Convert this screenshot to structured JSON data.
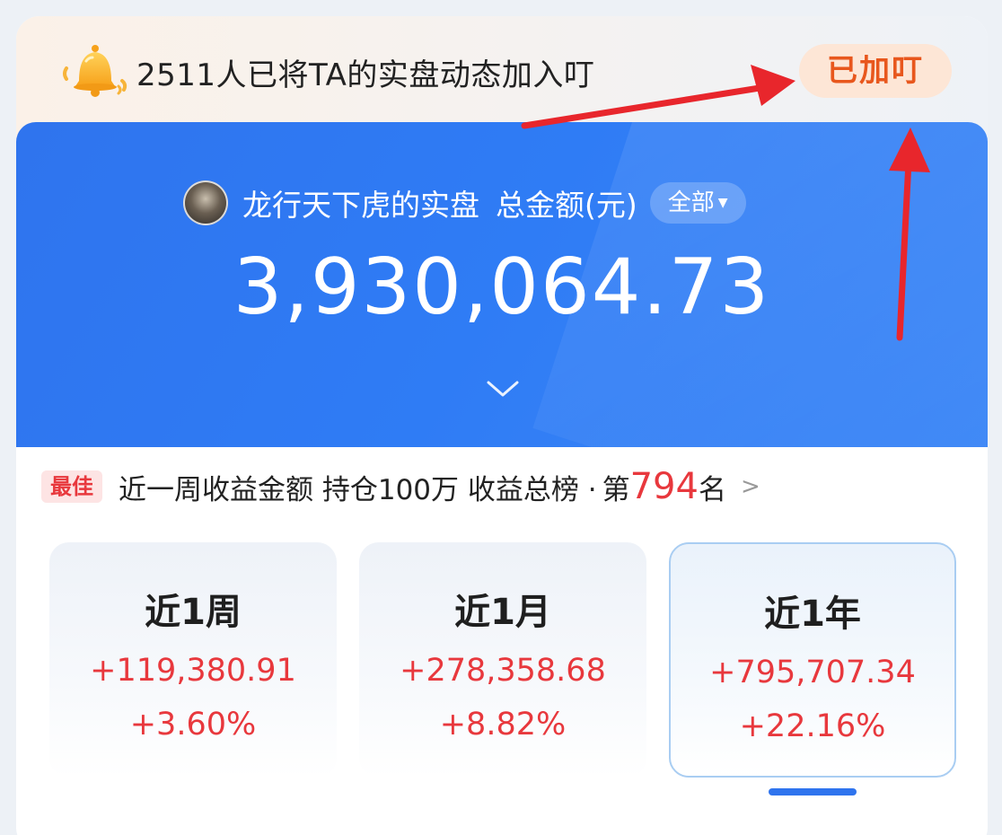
{
  "notify": {
    "text": "2511人已将TA的实盘动态加入叮",
    "button_label": "已加叮"
  },
  "hero": {
    "account_name": "龙行天下虎的实盘",
    "total_label": "总金额(元)",
    "scope_label": "全部",
    "total_amount": "3,930,064.73"
  },
  "rank": {
    "badge": "最佳",
    "text": "近一周收益金额 持仓100万 收益总榜 ·",
    "prefix": "第",
    "number": "794",
    "suffix": "名"
  },
  "periods": [
    {
      "label": "近1周",
      "amount": "+119,380.91",
      "pct": "+3.60%"
    },
    {
      "label": "近1月",
      "amount": "+278,358.68",
      "pct": "+8.82%"
    },
    {
      "label": "近1年",
      "amount": "+795,707.34",
      "pct": "+22.16%"
    }
  ],
  "icons": {
    "bell": "bell-icon",
    "scope_caret": "caret-down-icon",
    "expand": "chevron-down-icon",
    "rank_more": "chevron-right-icon"
  },
  "colors": {
    "brand_blue": "#2f74ee",
    "profit_red": "#e8383d",
    "follow_orange": "#e8571d",
    "annotation_arrow": "#e8262c"
  }
}
